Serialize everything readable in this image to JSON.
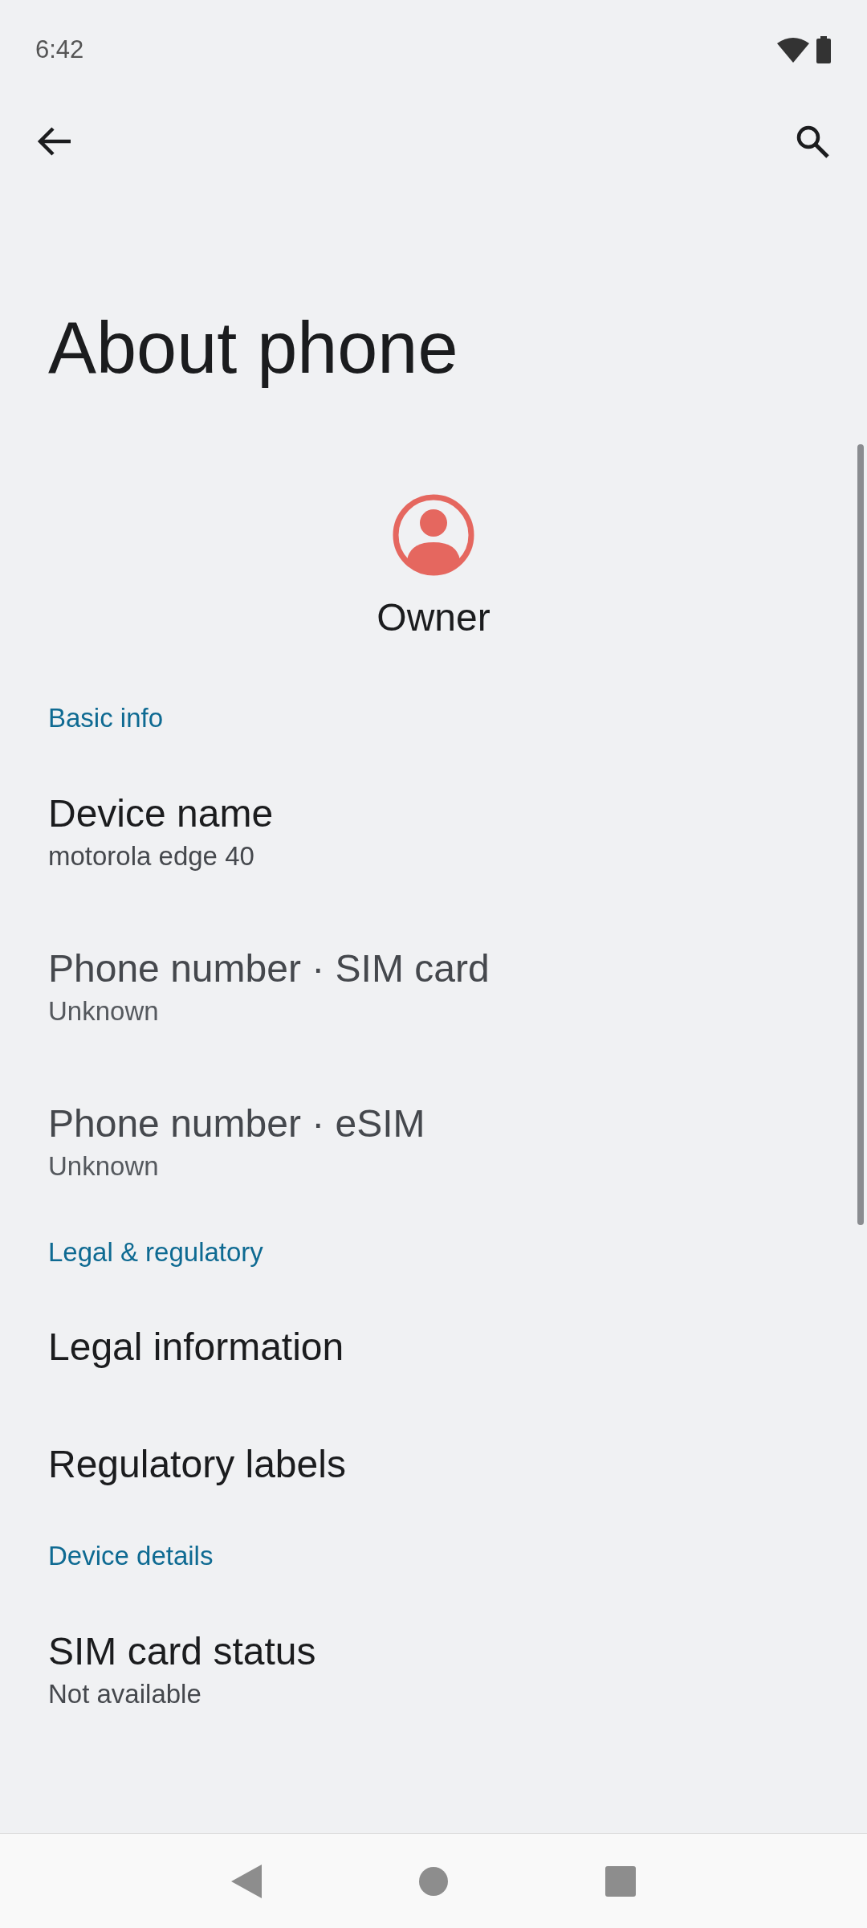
{
  "status_bar": {
    "time": "6:42"
  },
  "title": "About phone",
  "profile": {
    "name": "Owner"
  },
  "sections": [
    {
      "header": "Basic info",
      "items": [
        {
          "title": "Device name",
          "subtitle": "motorola edge 40",
          "disabled": false
        },
        {
          "title": "Phone number · SIM card",
          "subtitle": "Unknown",
          "disabled": true
        },
        {
          "title": "Phone number · eSIM",
          "subtitle": "Unknown",
          "disabled": true
        }
      ]
    },
    {
      "header": "Legal & regulatory",
      "items": [
        {
          "title": "Legal information",
          "disabled": false
        },
        {
          "title": "Regulatory labels",
          "disabled": false
        }
      ]
    },
    {
      "header": "Device details",
      "items": [
        {
          "title": "SIM card status",
          "subtitle": "Not available",
          "disabled": false
        }
      ]
    }
  ]
}
